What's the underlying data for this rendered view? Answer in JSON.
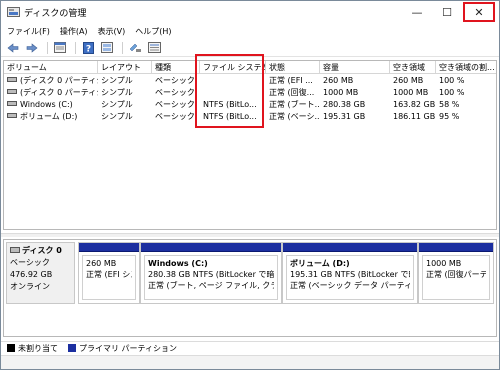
{
  "window": {
    "title": "ディスクの管理",
    "min_glyph": "—",
    "max_glyph": "☐",
    "close_glyph": "✕"
  },
  "menu": [
    {
      "label": "ファイル(F)"
    },
    {
      "label": "操作(A)"
    },
    {
      "label": "表示(V)"
    },
    {
      "label": "ヘルプ(H)"
    }
  ],
  "toolbar": {
    "icons": [
      "back-arrow-icon",
      "forward-arrow-icon",
      "properties-icon",
      "help-icon",
      "refresh-icon",
      "view-icon"
    ]
  },
  "volumes": {
    "columns": [
      "ボリューム",
      "レイアウト",
      "種類",
      "ファイル システム",
      "状態",
      "容量",
      "空き領域",
      "空き領域の割..."
    ],
    "rows": [
      {
        "volume": "(ディスク 0 パーティショ...",
        "layout": "シンプル",
        "type": "ベーシック",
        "fs": "",
        "status": "正常 (EFI ...",
        "capacity": "260 MB",
        "free": "260 MB",
        "pct": "100 %"
      },
      {
        "volume": "(ディスク 0 パーティショ...",
        "layout": "シンプル",
        "type": "ベーシック",
        "fs": "",
        "status": "正常 (回復...",
        "capacity": "1000 MB",
        "free": "1000 MB",
        "pct": "100 %"
      },
      {
        "volume": "Windows (C:)",
        "layout": "シンプル",
        "type": "ベーシック",
        "fs": "NTFS (BitLo...",
        "status": "正常 (ブート...",
        "capacity": "280.38 GB",
        "free": "163.82 GB",
        "pct": "58 %"
      },
      {
        "volume": "ボリューム (D:)",
        "layout": "シンプル",
        "type": "ベーシック",
        "fs": "NTFS (BitLo...",
        "status": "正常 (ベーシ...",
        "capacity": "195.31 GB",
        "free": "186.11 GB",
        "pct": "95 %"
      }
    ]
  },
  "disk": {
    "name": "ディスク 0",
    "type": "ベーシック",
    "size": "476.92 GB",
    "state": "オンライン"
  },
  "partitions": [
    {
      "title": "",
      "line1": "260 MB",
      "line2": "正常 (EFI システ"
    },
    {
      "title": "Windows (C:)",
      "line1": "280.38 GB NTFS (BitLocker で暗号化",
      "line2": "正常 (ブート, ページ ファイル, クラッシュ ダ"
    },
    {
      "title": "ボリューム (D:)",
      "line1": "195.31 GB NTFS (BitLocker で暗号化",
      "line2": "正常 (ベーシック データ パーティション)"
    },
    {
      "title": "",
      "line1": "1000 MB",
      "line2": "正常 (回復パーティ"
    }
  ],
  "legend": [
    {
      "label": "未割り当て",
      "color": "#000000"
    },
    {
      "label": "プライマリ パーティション",
      "color": "#1c2fa0"
    }
  ],
  "colors": {
    "highlight": "#e0141e",
    "partition_bar": "#1c2fa0"
  }
}
